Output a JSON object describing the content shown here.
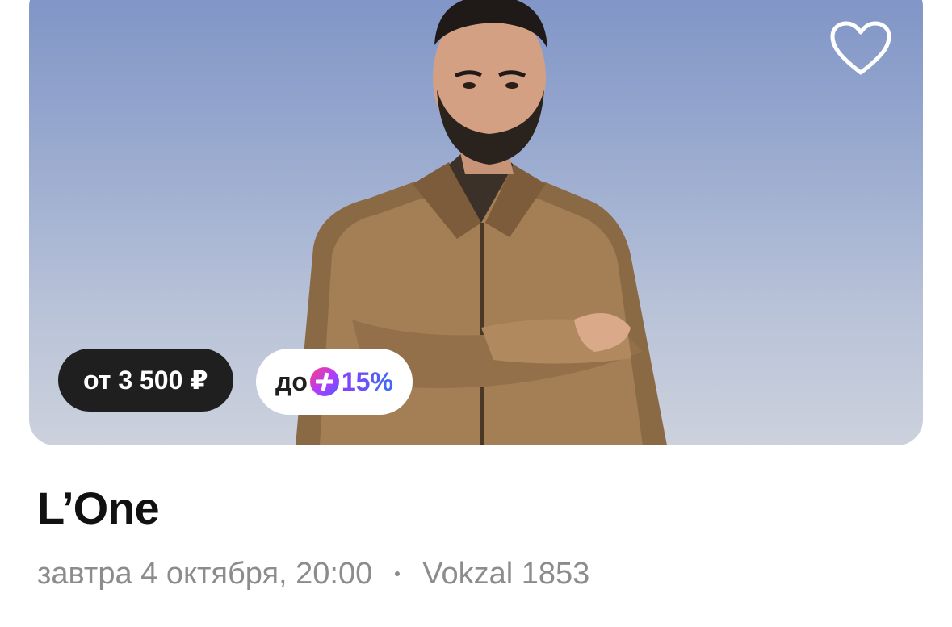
{
  "event": {
    "title": "L’One",
    "date_time": "завтра 4 октября, 20:00",
    "venue": "Vokzal 1853"
  },
  "card": {
    "price_label": "от 3 500 ₽",
    "cashback_prefix": "до",
    "cashback_icon": "plus-points-icon",
    "cashback_value": "15%",
    "favorite_icon": "heart-outline-icon"
  },
  "colors": {
    "price_badge_bg": "#1f1f1f",
    "cashback_gradient_start": "#8a3ffc",
    "cashback_gradient_end": "#3c6cf0",
    "meta_text": "#8c8c8c",
    "photo_bg_top": "#7e93c6",
    "photo_bg_bottom": "#ccd1dc"
  }
}
